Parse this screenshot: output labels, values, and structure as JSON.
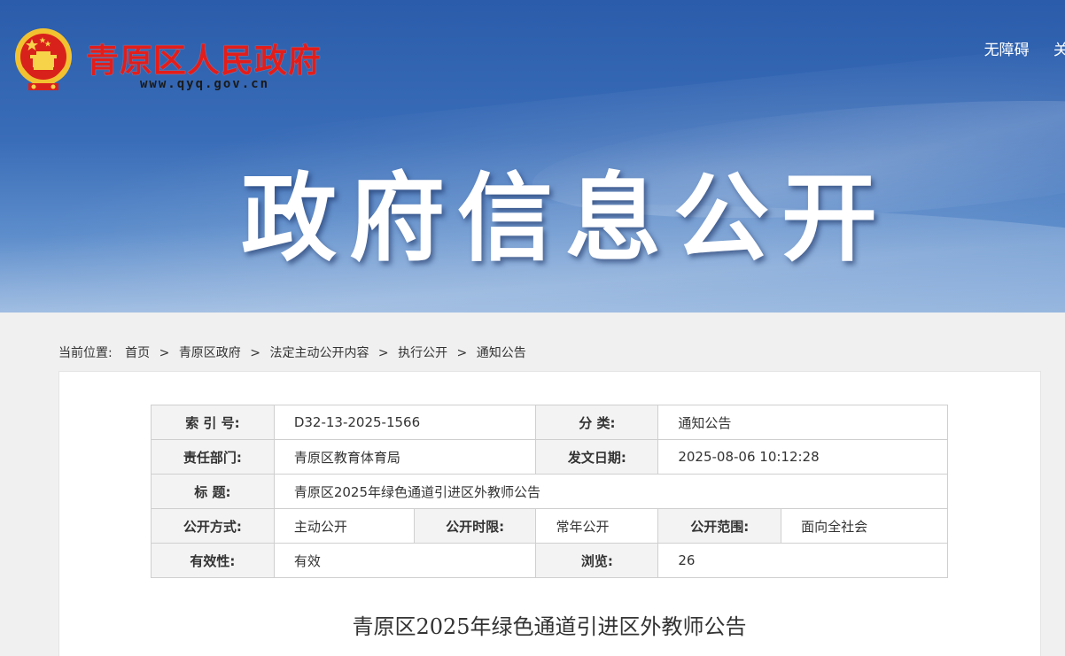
{
  "header": {
    "site_name": "青原区人民政府",
    "site_url": "www.qyq.gov.cn",
    "links": [
      "无障碍",
      "关"
    ],
    "banner_title": "政府信息公开"
  },
  "breadcrumb": {
    "label": "当前位置:",
    "items": [
      "首页",
      "青原区政府",
      "法定主动公开内容",
      "执行公开",
      "通知公告"
    ]
  },
  "meta": {
    "index_no_label": "索 引 号:",
    "index_no": "D32-13-2025-1566",
    "category_label": "分 类:",
    "category": "通知公告",
    "dept_label": "责任部门:",
    "dept": "青原区教育体育局",
    "date_label": "发文日期:",
    "date": "2025-08-06 10:12:28",
    "title_label": "标 题:",
    "title": "青原区2025年绿色通道引进区外教师公告",
    "mode_label": "公开方式:",
    "mode": "主动公开",
    "limit_label": "公开时限:",
    "limit": "常年公开",
    "scope_label": "公开范围:",
    "scope": "面向全社会",
    "validity_label": "有效性:",
    "validity": "有效",
    "views_label": "浏览:",
    "views": "26"
  },
  "article": {
    "title": "青原区2025年绿色通道引进区外教师公告"
  }
}
